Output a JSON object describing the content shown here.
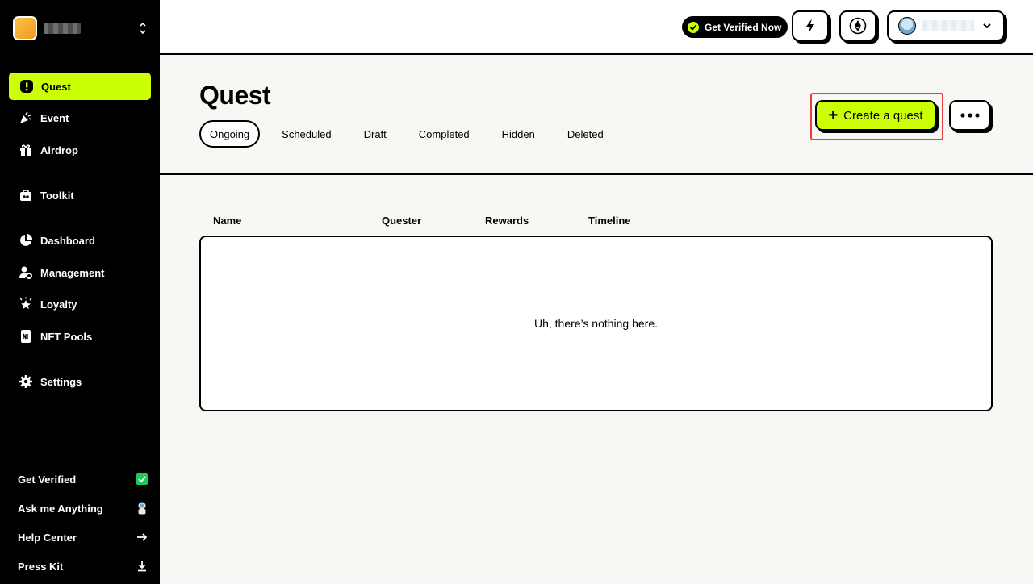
{
  "sidebar": {
    "nav": [
      {
        "label": "Quest",
        "icon": "quest-icon",
        "active": true
      },
      {
        "label": "Event",
        "icon": "party-popper-icon"
      },
      {
        "label": "Airdrop",
        "icon": "gift-icon"
      },
      {
        "label": "Toolkit",
        "icon": "toolkit-icon"
      },
      {
        "label": "Dashboard",
        "icon": "pie-chart-icon"
      },
      {
        "label": "Management",
        "icon": "user-gear-icon"
      },
      {
        "label": "Loyalty",
        "icon": "sparkle-star-icon"
      },
      {
        "label": "NFT Pools",
        "icon": "nft-icon"
      },
      {
        "label": "Settings",
        "icon": "gear-icon"
      }
    ],
    "footer": [
      {
        "label": "Get Verified",
        "icon": "checkbox-checked-icon"
      },
      {
        "label": "Ask me Anything",
        "icon": "astronaut-icon"
      },
      {
        "label": "Help Center",
        "icon": "arrow-right-icon"
      },
      {
        "label": "Press Kit",
        "icon": "download-icon"
      }
    ]
  },
  "header": {
    "verify_label": "Get Verified Now",
    "icons": [
      "lightning-icon",
      "ethereum-icon",
      "chevron-down-icon"
    ]
  },
  "page": {
    "title": "Quest",
    "tabs": [
      "Ongoing",
      "Scheduled",
      "Draft",
      "Completed",
      "Hidden",
      "Deleted"
    ],
    "active_tab": "Ongoing",
    "create_label": "Create a quest"
  },
  "table": {
    "columns": [
      "Name",
      "Quester",
      "Rewards",
      "Timeline"
    ],
    "empty_message": "Uh, there’s nothing here."
  },
  "colors": {
    "accent": "#cbff05",
    "highlight_border": "#e5403f",
    "verified_green": "#22c55e"
  }
}
